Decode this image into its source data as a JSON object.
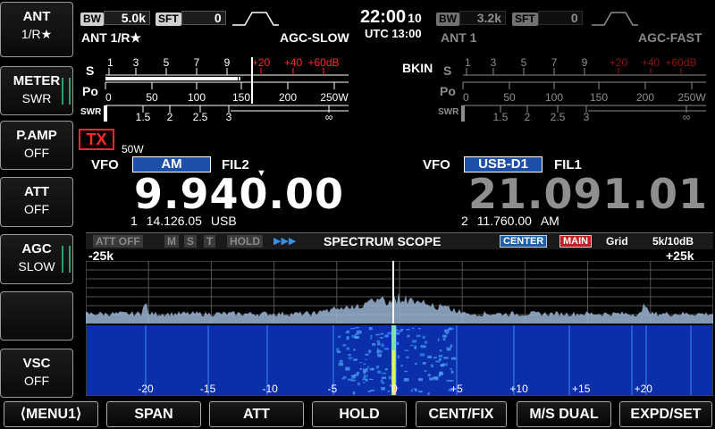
{
  "side_buttons": [
    {
      "title": "ANT",
      "value": "1/R★"
    },
    {
      "title": "METER",
      "value": "SWR"
    },
    {
      "title": "P.AMP",
      "value": "OFF"
    },
    {
      "title": "ATT",
      "value": "OFF"
    },
    {
      "title": "AGC",
      "value": "SLOW"
    },
    {
      "title": "",
      "value": ""
    },
    {
      "title": "VSC",
      "value": "OFF"
    }
  ],
  "main_rx": {
    "bw_label": "BW",
    "bw_value": "5.0k",
    "sft_label": "SFT",
    "sft_value": "0",
    "ant": "ANT 1/R★",
    "agc": "AGC-SLOW",
    "tx_badge": "TX",
    "power": "50W",
    "vfo_label": "VFO",
    "mode": "AM",
    "filter": "FIL2",
    "frequency": "9.940.00",
    "memo_ch": "1",
    "memo_freq": "14.126.05",
    "memo_mode": "USB"
  },
  "sub_rx": {
    "bw_label": "BW",
    "bw_value": "3.2k",
    "sft_label": "SFT",
    "sft_value": "0",
    "ant": "ANT 1",
    "agc": "AGC-FAST",
    "bkin": "BKIN",
    "vfo_label": "VFO",
    "mode": "USB-D1",
    "filter": "FIL1",
    "frequency": "21.091.01",
    "memo_ch": "2",
    "memo_freq": "11.760.00",
    "memo_mode": "AM"
  },
  "clock": {
    "time": "22:00",
    "seconds": "10",
    "utc": "UTC 13:00"
  },
  "meter": {
    "s_label": "S",
    "po_label": "Po",
    "swr_label": "SWR",
    "s_scale": [
      "1",
      "3",
      "5",
      "7",
      "9",
      "+20",
      "+40",
      "+60dB"
    ],
    "po_scale": [
      "0",
      "50",
      "100",
      "150",
      "200",
      "250W"
    ],
    "swr_scale": [
      "1",
      "1.5",
      "2",
      "2.5",
      "3",
      "∞"
    ]
  },
  "scope": {
    "att": "ATT OFF",
    "m": "M",
    "s": "S",
    "t": "T",
    "hold": "HOLD",
    "arrows": "▶▶▶",
    "title": "SPECTRUM SCOPE",
    "center": "CENTER",
    "main": "MAIN",
    "grid": "Grid",
    "span_ref": "5k/10dB",
    "left_edge": "-25k",
    "right_edge": "+25k",
    "axis_labels": [
      "-20",
      "-15",
      "-10",
      "-5",
      "0",
      "+5",
      "+10",
      "+15",
      "+20"
    ]
  },
  "menu": [
    "⟨MENU1⟩",
    "SPAN",
    "ATT",
    "HOLD",
    "CENT/FIX",
    "M/S DUAL",
    "EXPD/SET"
  ],
  "colors": {
    "accent_red": "#ff2a2a",
    "mode_blue": "#1d4fa8",
    "waterfall": "#0a2fa8",
    "spectrum": "#9ab4d4"
  }
}
